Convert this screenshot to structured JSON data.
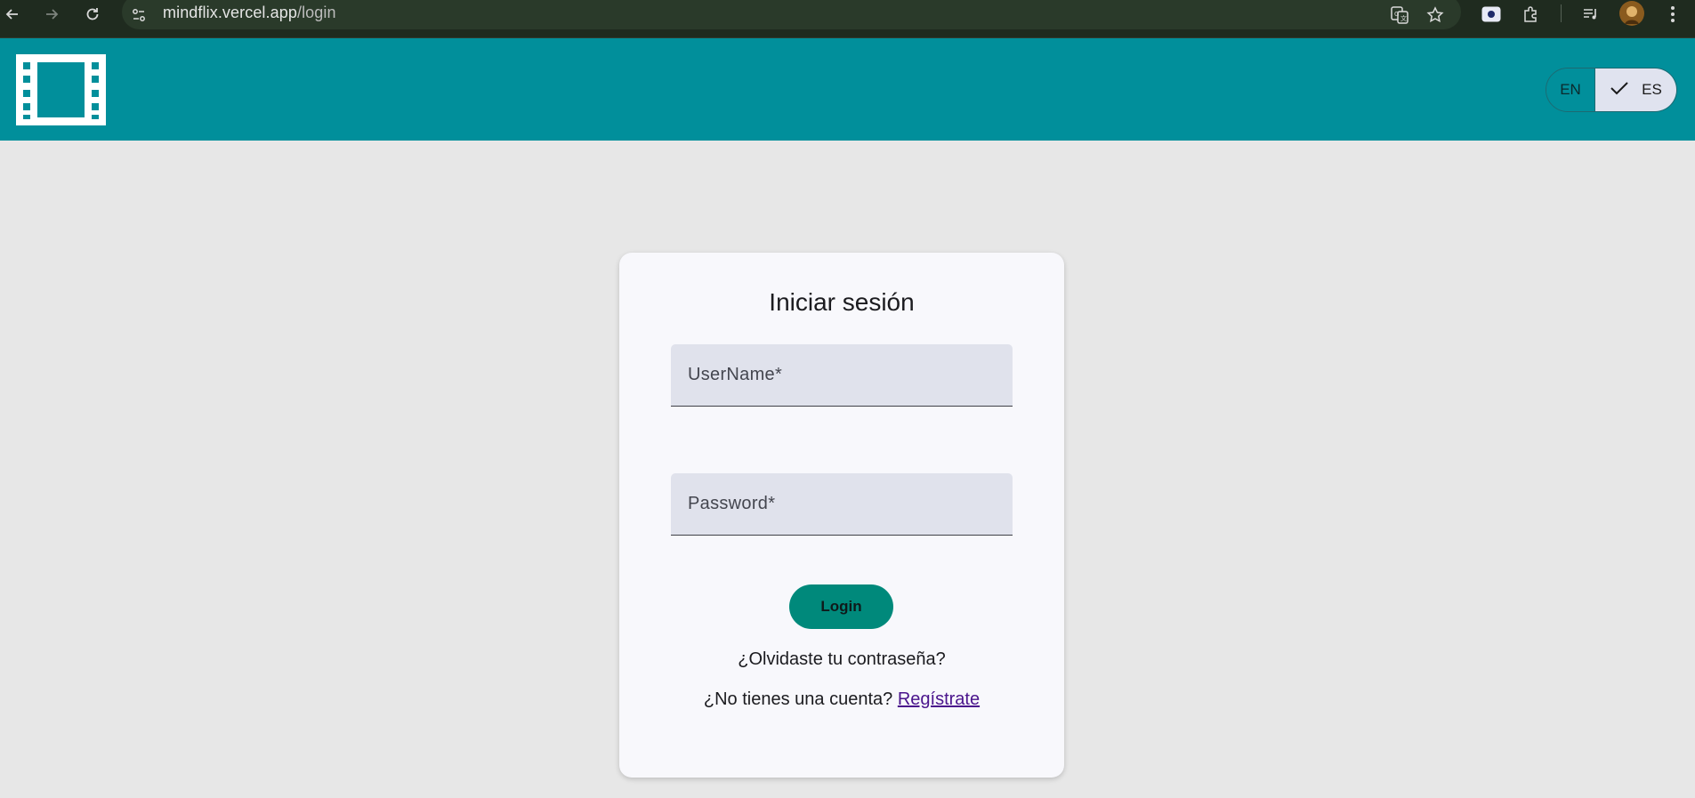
{
  "browser": {
    "url_host": "mindflix.vercel.app",
    "url_path": "/login",
    "icons": [
      "back-arrow-icon",
      "forward-arrow-icon",
      "reload-icon",
      "site-info-icon",
      "translate-icon",
      "bookmark-star-icon",
      "screen-cast-icon",
      "extensions-icon",
      "reading-list-icon",
      "profile-avatar",
      "more-menu-icon"
    ]
  },
  "header": {
    "logo_icon": "film-strip-icon",
    "brand_color": "#018f9b",
    "language_toggle": {
      "options": [
        "EN",
        "ES"
      ],
      "selected": "ES",
      "check_icon": "check-icon"
    }
  },
  "login_card": {
    "title": "Iniciar sesión",
    "username_placeholder": "UserName*",
    "password_placeholder": "Password*",
    "login_button": "Login",
    "forgot_password": "¿Olvidaste tu contraseña?",
    "no_account_prefix": "¿No tienes una cuenta?",
    "register_link": "Regístrate"
  },
  "colors": {
    "page_background": "#e7e7e7",
    "card_background": "#f8f8fc",
    "button_color": "#00897b",
    "link_color": "#4a148c"
  }
}
